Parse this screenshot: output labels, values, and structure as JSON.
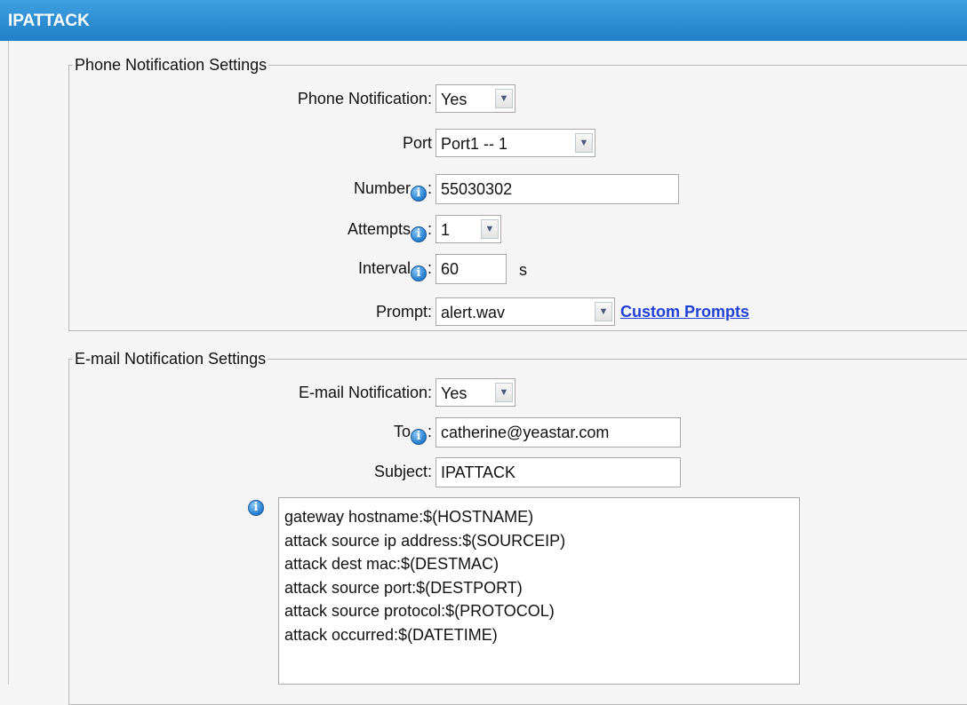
{
  "title": "IPATTACK",
  "phone": {
    "legend": "Phone Notification Settings",
    "notification": {
      "label": "Phone Notification:",
      "value": "Yes"
    },
    "port": {
      "label": "Port",
      "value": "Port1 -- 1"
    },
    "number": {
      "label": "Number",
      "value": "55030302"
    },
    "attempts": {
      "label": "Attempts",
      "value": "1"
    },
    "interval": {
      "label": "Interval",
      "value": "60",
      "unit": "s"
    },
    "prompt": {
      "label": "Prompt:",
      "value": "alert.wav",
      "link": "Custom Prompts"
    }
  },
  "email": {
    "legend": "E-mail Notification Settings",
    "notification": {
      "label": "E-mail Notification:",
      "value": "Yes"
    },
    "to": {
      "label": "To",
      "value": "catherine@yeastar.com"
    },
    "subject": {
      "label": "Subject:",
      "value": "IPATTACK"
    },
    "body_lines": [
      "gateway hostname:$(HOSTNAME)",
      "attack source ip address:$(SOURCEIP)",
      "attack dest mac:$(DESTMAC)",
      "attack source port:$(DESTPORT)",
      "attack source protocol:$(PROTOCOL)",
      "attack occurred:$(DATETIME)"
    ]
  },
  "icons": {
    "info": "info-icon",
    "dropdown": "chevron-down-icon"
  },
  "colors": {
    "titlebar": "#2a8bd2",
    "link": "#1f3fd6"
  }
}
